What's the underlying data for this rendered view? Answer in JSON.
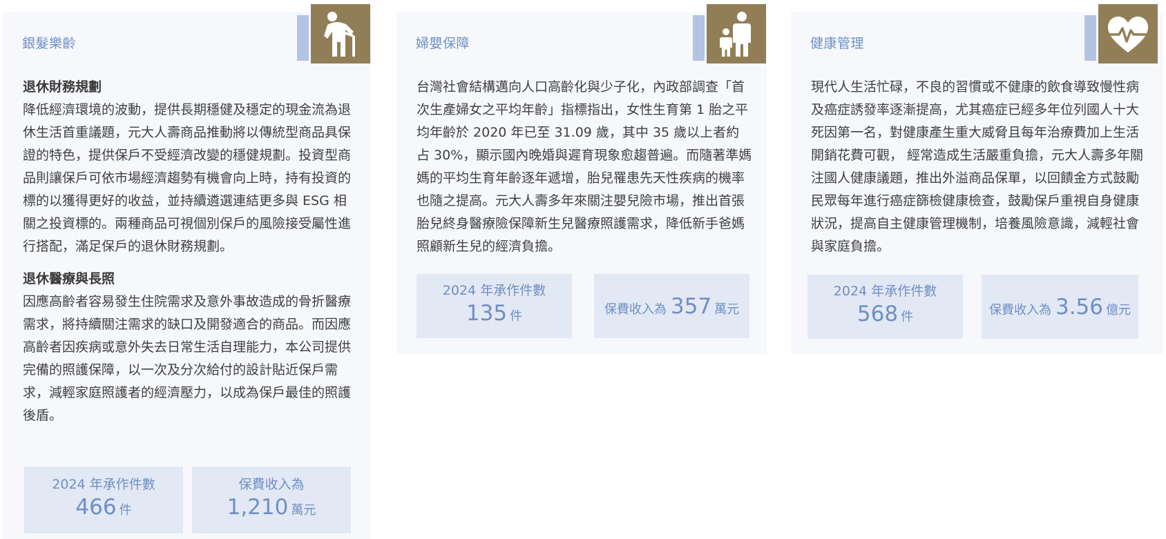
{
  "colors": {
    "card_bg": "#f6f8fc",
    "accent_blue": "#6f8fc4",
    "bar_blue": "#b3c3e4",
    "icon_gold": "#927e56",
    "stat_bg": "#e2e8f4",
    "text": "#3f3f3f"
  },
  "cards": [
    {
      "title": "銀髮樂齡",
      "icon": "elderly-person-icon",
      "sections": [
        {
          "heading": "退休財務規劃",
          "text": "降低經濟環境的波動，提供長期穩健及穩定的現金流為退休生活首重議題，元大人壽商品推動將以傳統型商品具保證的特色，提供保戶不受經濟改變的穩健規劃。投資型商品則讓保戶可依市場經濟趨勢有機會向上時，持有投資的標的以獲得更好的收益，並持續遴選連結更多與 ESG 相關之投資標的。兩種商品可視個別保戶的風險接受屬性進行搭配，滿足保戶的退休財務規劃。"
        },
        {
          "heading": "退休醫療與長照",
          "text": "因應高齡者容易發生住院需求及意外事故造成的骨折醫療需求，將持續關注需求的缺口及開發適合的商品。而因應高齡者因疾病或意外失去日常生活自理能力，本公司提供完備的照護保障，以一次及分次給付的設計貼近保戶需求，減輕家庭照護者的經濟壓力，以成為保戶最佳的照護後盾。"
        }
      ],
      "stats": [
        {
          "label": "2024 年承作件數",
          "value": "466",
          "unit": "件"
        },
        {
          "label": "保費收入為",
          "value": "1,210",
          "unit": "萬元"
        }
      ]
    },
    {
      "title": "婦嬰保障",
      "icon": "parent-child-icon",
      "sections": [
        {
          "heading": "",
          "text": "台灣社會結構邁向人口高齡化與少子化，內政部調查「首次生產婦女之平均年齡」指標指出，女性生育第 1 胎之平均年齡於 2020 年已至 31.09 歲，其中 35 歲以上者約占 30%，顯示國內晚婚與遲育現象愈趨普遍。而隨著準媽媽的平均生育年齡逐年遞增，胎兒罹患先天性疾病的機率也隨之提高。元大人壽多年來關注嬰兒險市場，推出首張胎兒終身醫療險保障新生兒醫療照護需求，降低新手爸媽照顧新生兒的經濟負擔。"
        }
      ],
      "stats": [
        {
          "label": "2024 年承作件數",
          "value": "135",
          "unit": "件"
        },
        {
          "label": "保費收入為",
          "value": "357",
          "unit": "萬元"
        }
      ]
    },
    {
      "title": "健康管理",
      "icon": "heartbeat-icon",
      "sections": [
        {
          "heading": "",
          "text": "現代人生活忙碌，不良的習慣或不健康的飲食導致慢性病及癌症誘發率逐漸提高，尤其癌症已經多年位列國人十大死因第一名，對健康產生重大威脅且每年治療費加上生活開銷花費可觀， 經常造成生活嚴重負擔，元大人壽多年關注國人健康議題，推出外溢商品保單，以回饋金方式鼓勵民眾每年進行癌症篩檢健康檢查，鼓勵保戶重視自身健康狀況，提高自主健康管理機制，培養風險意識，減輕社會與家庭負擔。"
        }
      ],
      "stats": [
        {
          "label": "2024 年承作件數",
          "value": "568",
          "unit": "件"
        },
        {
          "label": "保費收入為",
          "value": "3.56",
          "unit": "億元"
        }
      ]
    }
  ]
}
